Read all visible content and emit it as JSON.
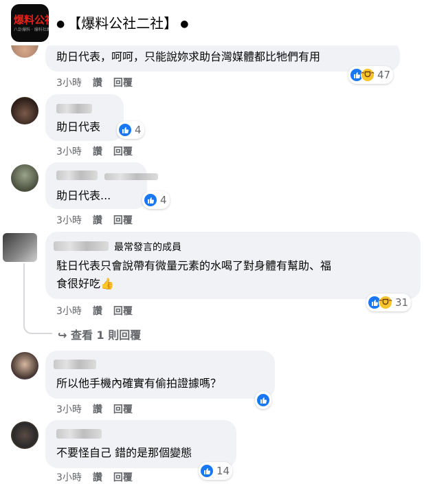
{
  "header": {
    "logo_text": "爆料公社",
    "logo_subtext": "八卦爆料 · 爆料社團",
    "group_name": "【爆料公社二社】"
  },
  "comments": [
    {
      "text": "助日代表，呵呵，只能說妳求助台灣媒體都比牠們有用",
      "time": "3小時",
      "like": "讚",
      "reply": "回覆",
      "reaction_count": "47"
    },
    {
      "text": "助日代表",
      "time": "3小時",
      "like": "讚",
      "reply": "回覆",
      "reaction_count": "4"
    },
    {
      "text": "助日代表...",
      "time": "3小時",
      "like": "讚",
      "reply": "回覆",
      "reaction_count": "4"
    },
    {
      "badge": "最常發言的成員",
      "text_line1": "駐日代表只會說帶有微量元素的水喝了對身體有幫助、福",
      "text_line2": "食很好吃",
      "emoji": "👍",
      "time": "3小時",
      "like": "讚",
      "reply": "回覆",
      "reaction_count": "31"
    },
    {
      "text": "所以他手機內確實有偷拍證據嗎？",
      "time": "3小時",
      "like": "讚",
      "reply": "回覆"
    },
    {
      "text": "不要怪自己 錯的是那個變態",
      "time": "3小時",
      "like": "讚",
      "reply": "回覆",
      "reaction_count": "14"
    }
  ],
  "view_replies": "查看 1 則回覆",
  "colors": {
    "like_blue": "#1877f2",
    "bubble": "#f0f2f5",
    "meta_gray": "#65676b",
    "haha_yellow": "#f7c52b"
  }
}
